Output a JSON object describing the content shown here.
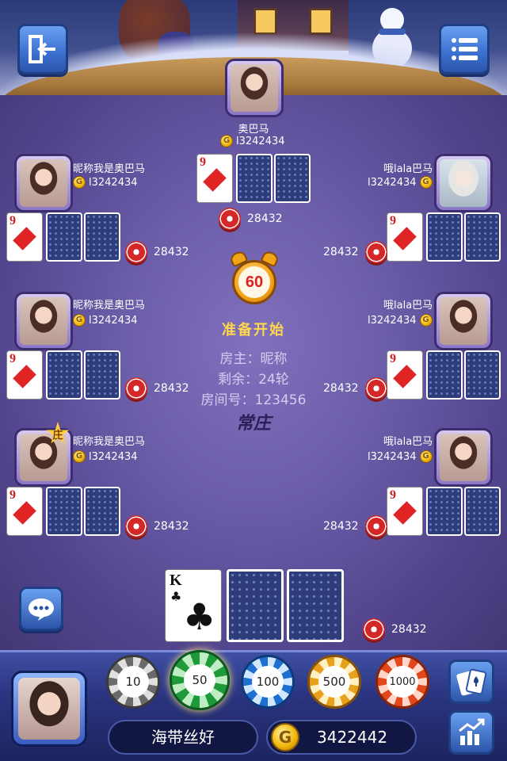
{
  "top_player": {
    "name": "奥巴马",
    "coins": "l3242434",
    "bet": "28432"
  },
  "left_players": [
    {
      "name": "昵称我是奥巴马",
      "coins": "l3242434",
      "bet": "28432",
      "card_rank": "9"
    },
    {
      "name": "昵称我是奥巴马",
      "coins": "l3242434",
      "bet": "28432",
      "card_rank": "9"
    },
    {
      "name": "昵称我是奥巴马",
      "coins": "l3242434",
      "bet": "28432",
      "card_rank": "9",
      "banker_badge": "庄"
    }
  ],
  "right_players": [
    {
      "name": "哦lala巴马",
      "coins": "l3242434",
      "bet": "28432",
      "card_rank": "9"
    },
    {
      "name": "哦lala巴马",
      "coins": "l3242434",
      "bet": "28432",
      "card_rank": "9"
    },
    {
      "name": "哦lala巴马",
      "coins": "l3242434",
      "bet": "28432",
      "card_rank": "9"
    }
  ],
  "top_card_rank": "9",
  "center": {
    "timer": "60",
    "status": "准备开始",
    "owner": "房主：昵称",
    "remaining": "剩余：24轮",
    "room": "房间号：123456",
    "mode": "常庄"
  },
  "self": {
    "card_rank": "K",
    "card_suit": "♣",
    "bet": "28432",
    "name": "海带丝好",
    "gold": "3422442"
  },
  "chips": [
    "10",
    "50",
    "100",
    "500",
    "1000"
  ],
  "coin_symbol": "G",
  "icons": {
    "exit": "exit-icon",
    "menu": "menu-list-icon",
    "chat": "chat-bubble-icon",
    "cards": "cards-icon",
    "stats": "chart-icon"
  },
  "colors": {
    "felt": "#6d5eaa",
    "gold_text": "#ffd84a",
    "card_red": "#e02424",
    "button_blue": "#3a6fd0"
  }
}
